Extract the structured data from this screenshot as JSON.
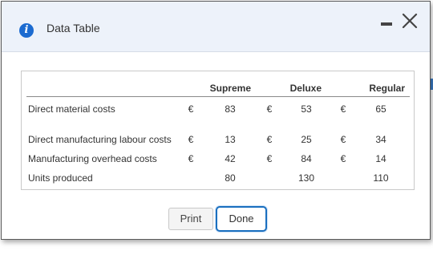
{
  "dialog": {
    "title": "Data Table",
    "icon": "info-icon",
    "minimize_icon": "minimize-icon",
    "close_icon": "close-icon"
  },
  "table": {
    "headers": [
      "",
      "Supreme",
      "Deluxe",
      "Regular"
    ],
    "currency": "€",
    "rows": [
      {
        "label": "Direct material costs",
        "cur": [
          "€",
          "€",
          "€"
        ],
        "values": [
          "83",
          "53",
          "65"
        ]
      },
      {
        "label": "Direct manufacturing labour costs",
        "cur": [
          "€",
          "€",
          "€"
        ],
        "values": [
          "13",
          "25",
          "34"
        ]
      },
      {
        "label": "Manufacturing overhead costs",
        "cur": [
          "€",
          "€",
          "€"
        ],
        "values": [
          "42",
          "84",
          "14"
        ]
      },
      {
        "label": "Units produced",
        "cur": [
          "",
          "",
          ""
        ],
        "values": [
          "80",
          "130",
          "110"
        ]
      }
    ]
  },
  "buttons": {
    "print": "Print",
    "done": "Done"
  },
  "colors": {
    "titlebar_bg": "#edf2fa",
    "accent": "#1a6fbf",
    "info_icon": "#1c6bd0"
  }
}
